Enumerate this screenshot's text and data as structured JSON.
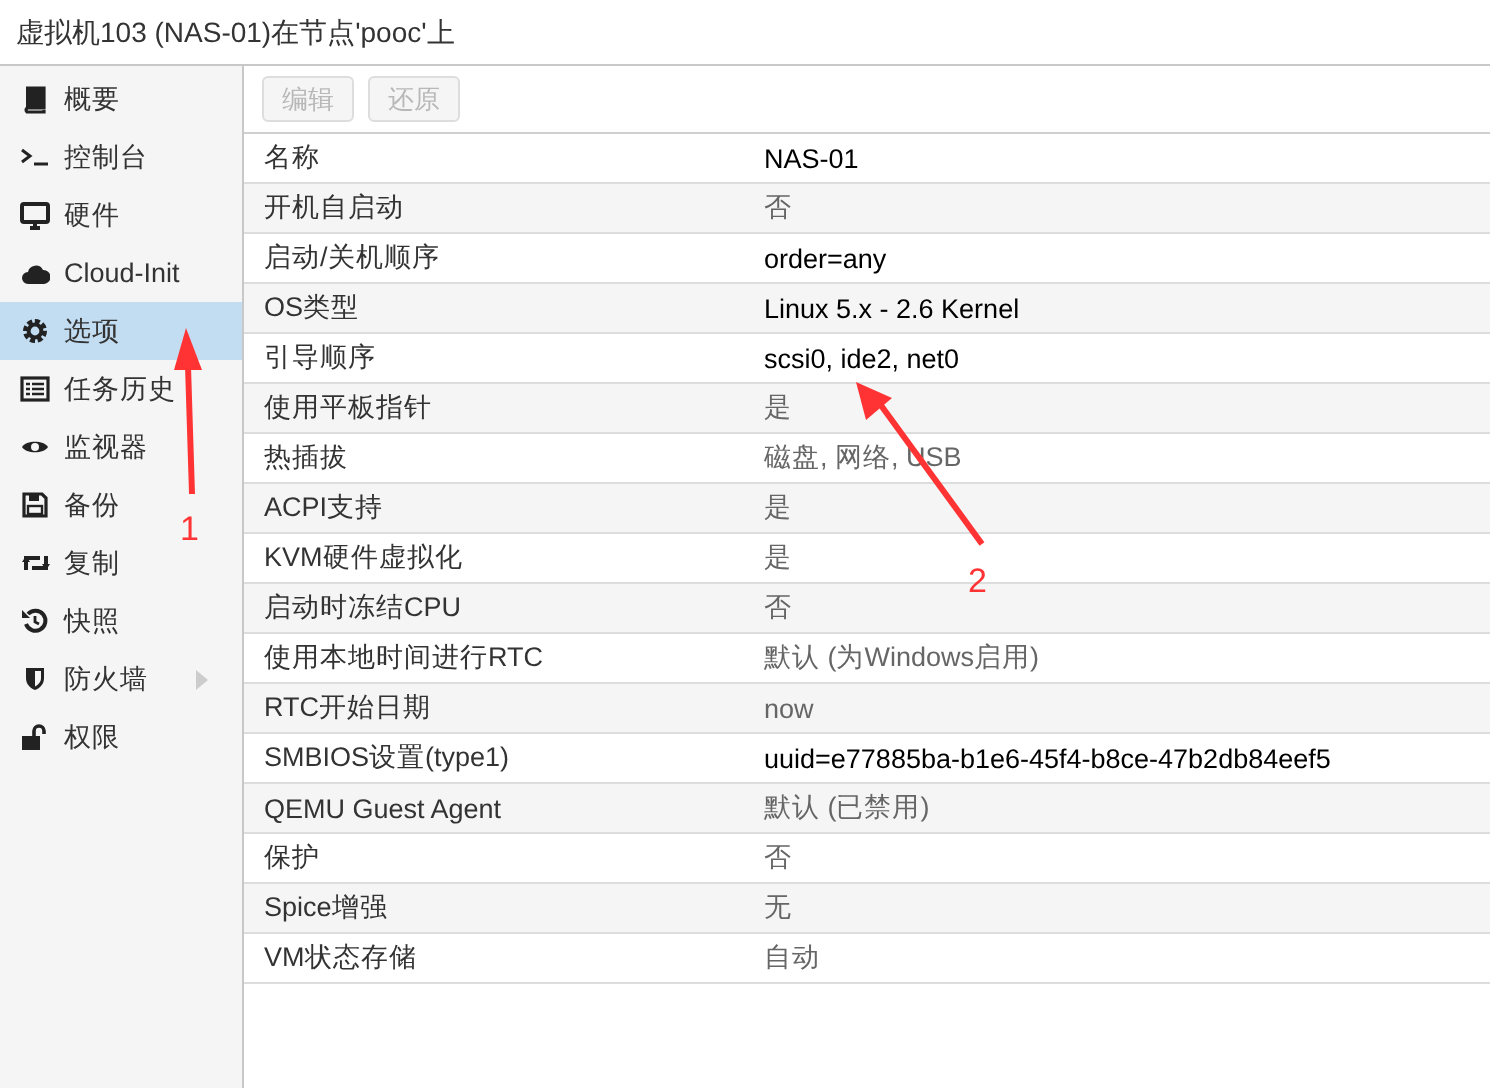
{
  "window": {
    "title": "虚拟机103 (NAS-01)在节点'pooc'上"
  },
  "sidebar": {
    "items": [
      {
        "label": "概要",
        "selected": false,
        "submenu": false
      },
      {
        "label": "控制台",
        "selected": false,
        "submenu": false
      },
      {
        "label": "硬件",
        "selected": false,
        "submenu": false
      },
      {
        "label": "Cloud-Init",
        "selected": false,
        "submenu": false
      },
      {
        "label": "选项",
        "selected": true,
        "submenu": false
      },
      {
        "label": "任务历史",
        "selected": false,
        "submenu": false
      },
      {
        "label": "监视器",
        "selected": false,
        "submenu": false
      },
      {
        "label": "备份",
        "selected": false,
        "submenu": false
      },
      {
        "label": "复制",
        "selected": false,
        "submenu": false
      },
      {
        "label": "快照",
        "selected": false,
        "submenu": false
      },
      {
        "label": "防火墙",
        "selected": false,
        "submenu": true
      },
      {
        "label": "权限",
        "selected": false,
        "submenu": false
      }
    ]
  },
  "toolbar": {
    "buttons": [
      {
        "label": "编辑",
        "disabled": true
      },
      {
        "label": "还原",
        "disabled": true
      }
    ]
  },
  "table": {
    "rows": [
      {
        "name": "名称",
        "value": "NAS-01",
        "default": false
      },
      {
        "name": "开机自启动",
        "value": "否",
        "default": true
      },
      {
        "name": "启动/关机顺序",
        "value": "order=any",
        "default": false
      },
      {
        "name": "OS类型",
        "value": "Linux 5.x - 2.6 Kernel",
        "default": false
      },
      {
        "name": "引导顺序",
        "value": "scsi0, ide2, net0",
        "default": false
      },
      {
        "name": "使用平板指针",
        "value": "是",
        "default": true
      },
      {
        "name": "热插拔",
        "value": "磁盘, 网络, USB",
        "default": true
      },
      {
        "name": "ACPI支持",
        "value": "是",
        "default": true
      },
      {
        "name": "KVM硬件虚拟化",
        "value": "是",
        "default": true
      },
      {
        "name": "启动时冻结CPU",
        "value": "否",
        "default": true
      },
      {
        "name": "使用本地时间进行RTC",
        "value": "默认 (为Windows启用)",
        "default": true
      },
      {
        "name": "RTC开始日期",
        "value": "now",
        "default": true
      },
      {
        "name": "SMBIOS设置(type1)",
        "value": "uuid=e77885ba-b1e6-45f4-b8ce-47b2db84eef5",
        "default": false
      },
      {
        "name": "QEMU Guest Agent",
        "value": "默认 (已禁用)",
        "default": true
      },
      {
        "name": "保护",
        "value": "否",
        "default": true
      },
      {
        "name": "Spice增强",
        "value": "无",
        "default": true
      },
      {
        "name": "VM状态存储",
        "value": "自动",
        "default": true
      }
    ]
  },
  "annotations": [
    {
      "label": "1"
    },
    {
      "label": "2"
    }
  ]
}
